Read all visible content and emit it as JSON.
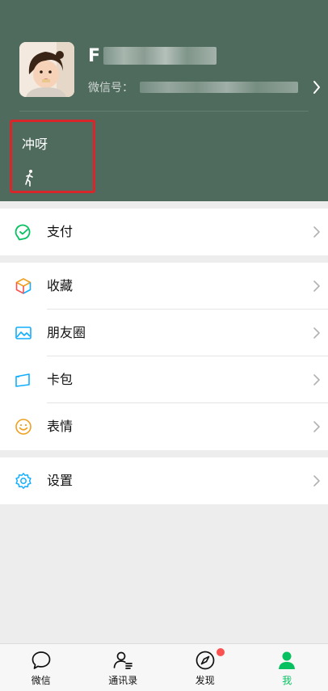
{
  "profile": {
    "name_visible": "F",
    "wechat_id_label": "微信号："
  },
  "status": {
    "text": "冲呀"
  },
  "menu": {
    "pay": "支付",
    "favorites": "收藏",
    "moments": "朋友圈",
    "cards": "卡包",
    "stickers": "表情",
    "settings": "设置"
  },
  "tabs": {
    "chats": "微信",
    "contacts": "通讯录",
    "discover": "发现",
    "me": "我"
  },
  "colors": {
    "header_bg": "#4f6b5e",
    "accent_green": "#07c160",
    "highlight_red": "#d9262b",
    "badge_red": "#fa5151"
  }
}
